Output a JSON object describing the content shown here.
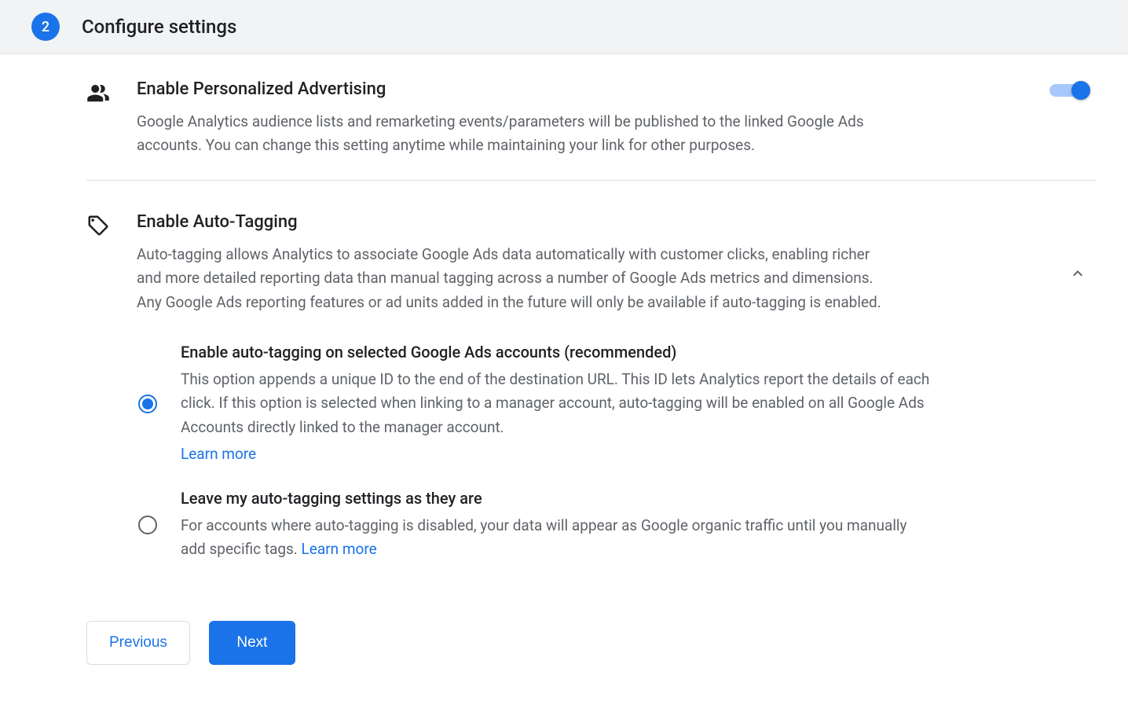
{
  "step": {
    "number": "2",
    "title": "Configure settings"
  },
  "sections": {
    "personalized_advertising": {
      "title": "Enable Personalized Advertising",
      "description": "Google Analytics audience lists and remarketing events/parameters will be published to the linked Google Ads accounts. You can change this setting anytime while maintaining your link for other purposes.",
      "toggle_on": true
    },
    "auto_tagging": {
      "title": "Enable Auto-Tagging",
      "description": "Auto-tagging allows Analytics to associate Google Ads data automatically with customer clicks, enabling richer and more detailed reporting data than manual tagging across a number of Google Ads metrics and dimensions. Any Google Ads reporting features or ad units added in the future will only be available if auto-tagging is enabled.",
      "options": [
        {
          "title": "Enable auto-tagging on selected Google Ads accounts (recommended)",
          "description": "This option appends a unique ID to the end of the destination URL. This ID lets Analytics report the details of each click. If this option is selected when linking to a manager account, auto-tagging will be enabled on all Google Ads Accounts directly linked to the manager account.",
          "learn_more": "Learn more",
          "selected": true
        },
        {
          "title": "Leave my auto-tagging settings as they are",
          "description": "For accounts where auto-tagging is disabled, your data will appear as Google organic traffic until you manually add specific tags.",
          "learn_more": "Learn more",
          "selected": false
        }
      ]
    }
  },
  "buttons": {
    "previous": "Previous",
    "next": "Next"
  }
}
